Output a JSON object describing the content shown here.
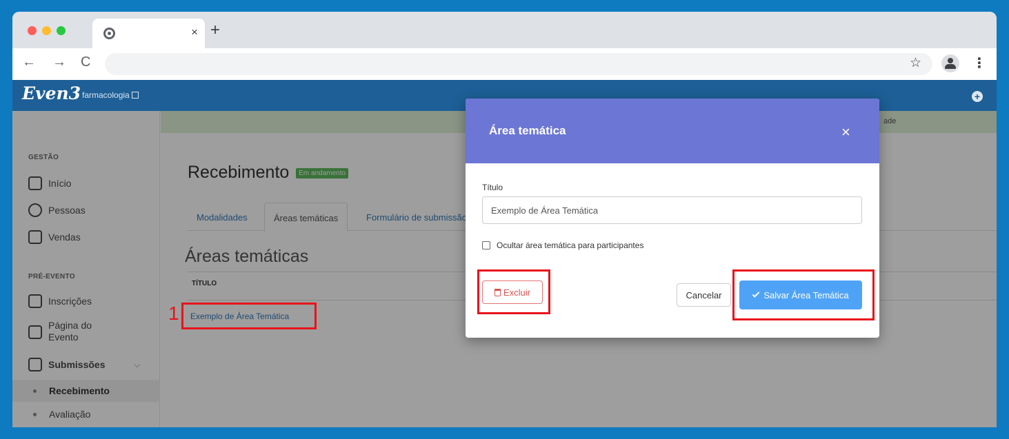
{
  "browser": {
    "tab_close": "×",
    "new_tab": "+",
    "back": "←",
    "forward": "→",
    "reload": "C",
    "star": "☆",
    "menu": "⋮"
  },
  "app": {
    "logo": "Even3",
    "event_name": "farmacologia",
    "banner_text": "ade",
    "plus": "+",
    "icons": [
      "home-icon",
      "user-icon",
      "money-icon",
      "ticket-icon",
      "monitor-icon",
      "document-icon"
    ]
  },
  "sidebar": {
    "gestao_label": "GESTÃO",
    "items_gestao": [
      "Início",
      "Pessoas",
      "Vendas"
    ],
    "pre_evento_label": "PRÉ-EVENTO",
    "inscricoes": "Inscrições",
    "pagina_line1": "Página do",
    "pagina_line2": "Evento",
    "submissoes": "Submissões",
    "submissoes_chevron": "⌵",
    "sub_items": [
      "Recebimento",
      "Avaliação"
    ]
  },
  "main": {
    "page_title": "Recebimento",
    "status_badge": "Em andamento",
    "tabs": [
      "Modalidades",
      "Áreas temáticas",
      "Formulário de submissão"
    ],
    "section_title": "Áreas temáticas",
    "column_header": "TÍTULO",
    "rows": [
      "Exemplo de Área Temática"
    ]
  },
  "modal": {
    "title": "Área temática",
    "close": "×",
    "field_label": "Título",
    "field_value": "Exemplo de Área Temática",
    "checkbox_label": "Ocultar área temática para participantes",
    "delete_label": "Excluir",
    "cancel_label": "Cancelar",
    "save_label": "Salvar Área Temática"
  },
  "annotation": {
    "number": "1",
    "color": "#e8131b"
  },
  "colors": {
    "background": "#0e7ac0",
    "appbar": "#1d5f96",
    "modal_header": "#6c76d4",
    "save_button": "#4fa3f7",
    "link": "#337ab7",
    "badge": "#5cb85c"
  }
}
